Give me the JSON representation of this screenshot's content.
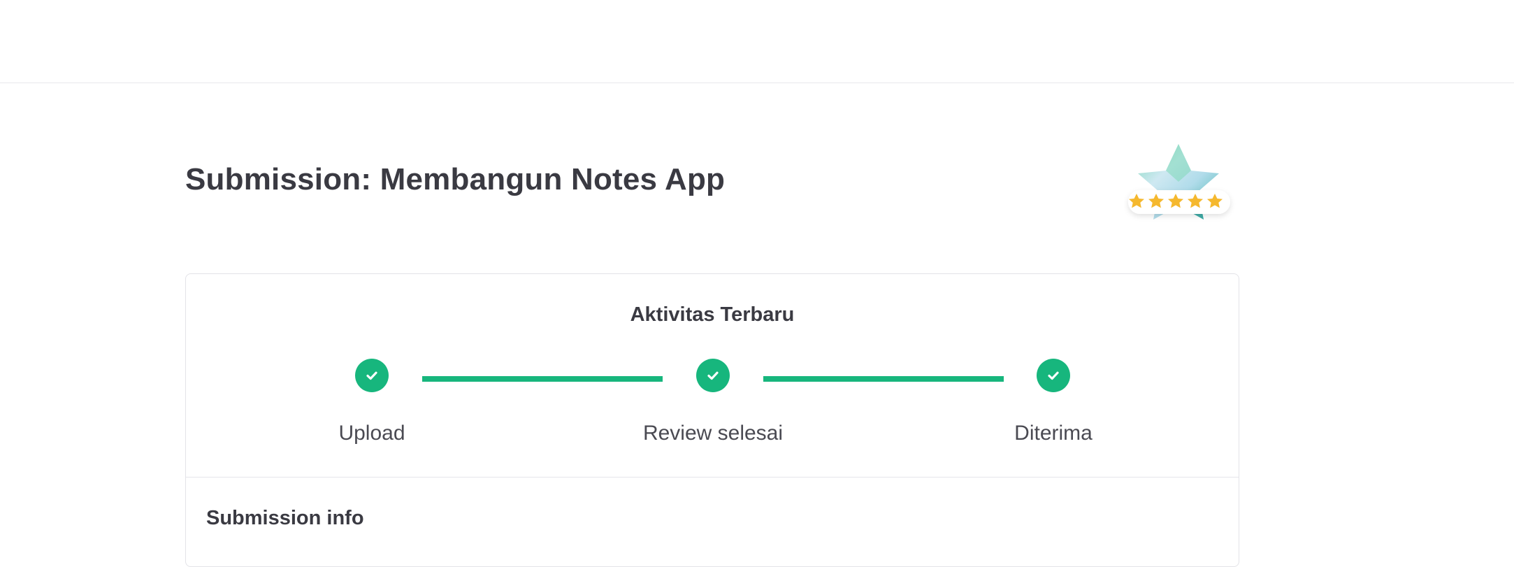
{
  "header": {},
  "page": {
    "title": "Submission: Membangun Notes App",
    "rating_stars": 5
  },
  "activity": {
    "heading": "Aktivitas Terbaru",
    "steps": [
      {
        "label": "Upload",
        "status": "completed"
      },
      {
        "label": "Review selesai",
        "status": "completed"
      },
      {
        "label": "Diterima",
        "status": "completed"
      }
    ]
  },
  "submission_info": {
    "title": "Submission info"
  },
  "colors": {
    "accent_green": "#17b67d",
    "star_yellow": "#f5b82e",
    "text_dark": "#3a3a42"
  }
}
